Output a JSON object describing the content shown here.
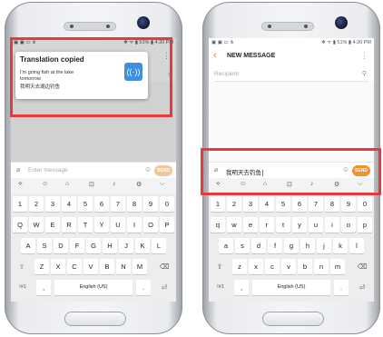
{
  "left": {
    "status": {
      "left_icons": "▣ ▣ ▭ ⋔",
      "right": "✻ ᯤ ▮ 51% ▮ 4:20 PM"
    },
    "popup": {
      "title": "Translation copied",
      "line1": "I'm going fish at the lake",
      "line2": "tomorrow",
      "line3": "我明天去湖边钓鱼",
      "icon": "translate-icon"
    },
    "message": {
      "placeholder": "Enter message",
      "send_label": "SEND"
    }
  },
  "right": {
    "status": {
      "left_icons": "▣ ▣ ▭ ⋔",
      "right": "✻ ᯤ ▮ 51% ▮ 4:20 PM"
    },
    "title": "NEW MESSAGE",
    "recipient_placeholder": "Recipient",
    "message": {
      "text": "我明天去钓鱼",
      "send_label": "SEND"
    }
  },
  "keyboard": {
    "toolbar": [
      "⟡",
      "☺",
      "⌂",
      "⊡",
      "♪",
      "⚙",
      "⌵"
    ],
    "row_numbers": [
      "1",
      "2",
      "3",
      "4",
      "5",
      "6",
      "7",
      "8",
      "9",
      "0"
    ],
    "left_rows": {
      "row1": [
        "Q",
        "W",
        "E",
        "R",
        "T",
        "Y",
        "U",
        "I",
        "O",
        "P"
      ],
      "row2": [
        "A",
        "S",
        "D",
        "F",
        "G",
        "H",
        "J",
        "K",
        "L"
      ],
      "row3": [
        "Z",
        "X",
        "C",
        "V",
        "B",
        "N",
        "M"
      ]
    },
    "right_rows": {
      "row1": [
        "q",
        "w",
        "e",
        "r",
        "t",
        "y",
        "u",
        "i",
        "o",
        "p"
      ],
      "row2": [
        "a",
        "s",
        "d",
        "f",
        "g",
        "h",
        "j",
        "k",
        "l"
      ],
      "row3": [
        "z",
        "x",
        "c",
        "v",
        "b",
        "n",
        "m"
      ]
    },
    "symbols_label": "!#1",
    "comma": ",",
    "space_label": "English (US)",
    "period": ".",
    "shift": "⇧",
    "backspace": "⌫",
    "enter": "⏎"
  },
  "colors": {
    "accent": "#f0932b",
    "highlight": "#e53b3b",
    "popup_icon": "#3d8fe0"
  }
}
